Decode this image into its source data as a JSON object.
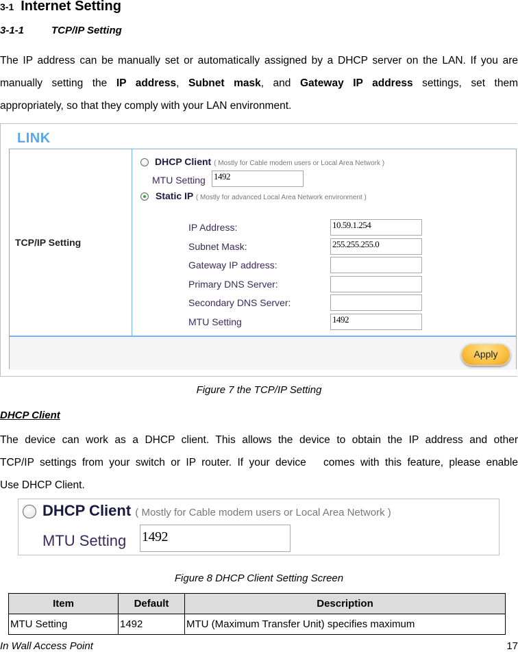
{
  "heading": {
    "number": "3-1",
    "title": "Internet Setting"
  },
  "subheading": {
    "number": "3-1-1",
    "title": "TCP/IP Setting"
  },
  "intro": {
    "line1": "The IP address can be manually set or automatically assigned by a DHCP server on the LAN. If you are",
    "line2_pre": "manually setting the ",
    "line2_b1": "IP address",
    "line2_sep1": ", ",
    "line2_b2": "Subnet mask",
    "line2_sep2": ", and ",
    "line2_b3": "Gateway IP address",
    "line2_post": " settings, set them",
    "line3": "appropriately, so that they comply with your LAN environment."
  },
  "figure7": {
    "panel_title": "LINK",
    "section_label": "TCP/IP Setting",
    "dhcp": {
      "label": "DHCP Client",
      "note": "( Mostly for Cable modem users or Local Area Network )",
      "selected": false
    },
    "dhcp_mtu": {
      "label": "MTU Setting",
      "value": "1492"
    },
    "static": {
      "label": "Static IP",
      "note": "( Mostly for advanced Local Area Network environment )",
      "selected": true
    },
    "fields": [
      {
        "label": "IP Address:",
        "value": "10.59.1.254"
      },
      {
        "label": "Subnet Mask:",
        "value": "255.255.255.0"
      },
      {
        "label": "Gateway IP address:",
        "value": ""
      },
      {
        "label": "Primary DNS Server:",
        "value": ""
      },
      {
        "label": "Secondary DNS Server:",
        "value": ""
      },
      {
        "label": "MTU Setting",
        "value": "1492"
      }
    ],
    "apply_label": "Apply",
    "caption": "Figure 7 the TCP/IP Setting"
  },
  "dhcp_section": {
    "heading": "DHCP Client",
    "line1": "The device can work as a DHCP client. This allows the device to obtain the IP address and other",
    "line2": "TCP/IP settings from your switch or IP router. If your device   comes with this feature, please enable",
    "line3": "Use DHCP Client."
  },
  "figure8": {
    "dhcp": {
      "label": "DHCP Client",
      "note": "( Mostly for Cable modem users or Local Area Network )",
      "selected": false
    },
    "mtu": {
      "label": "MTU Setting",
      "value": "1492"
    },
    "caption": "Figure 8 DHCP Client Setting Screen"
  },
  "table": {
    "headers": [
      "Item",
      "Default",
      "Description"
    ],
    "rows": [
      [
        "MTU Setting",
        "1492",
        "MTU (Maximum Transfer Unit) specifies maximum"
      ]
    ]
  },
  "footer": {
    "product": "In Wall Access Point",
    "page": "17"
  }
}
